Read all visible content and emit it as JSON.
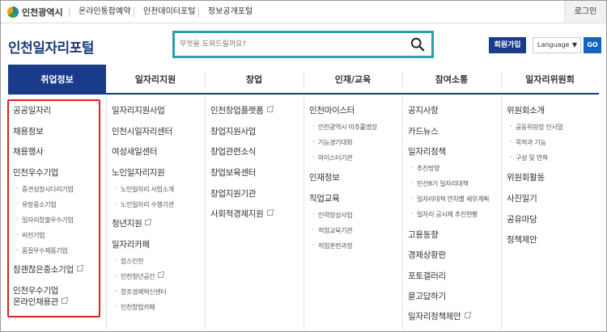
{
  "topbar": {
    "logo": "인천광역시",
    "links": [
      "온라인통합예약",
      "인천데이터포털",
      "정보공개포털"
    ],
    "login": "로그인"
  },
  "header": {
    "brand": "인천일자리포털",
    "search_placeholder": "무엇을 도와드릴까요?",
    "join": "회원가입",
    "language": "Language",
    "go": "GO"
  },
  "nav": [
    "취업정보",
    "일자리지원",
    "창업",
    "인재/교육",
    "참여소통",
    "일자리위원회"
  ],
  "menu": {
    "c1": [
      "공공일자리",
      "채용정보",
      "채용행사",
      "인천우수기업",
      "중견성장사다리기업",
      "유망중소기업",
      "일자리창출우수기업",
      "비전기업",
      "품질우수제품기업",
      "참괜찮은중소기업",
      "인천우수기업",
      "온라인채용관"
    ],
    "c2": [
      "일자리지원사업",
      "인천시일자리센터",
      "여성새일센터",
      "노인일자리지원",
      "노인일자리 사업소개",
      "노인일자리 수행기관",
      "청년지원",
      "일자리카페",
      "잡스인천",
      "인천청년공간",
      "창조경제혁신센터",
      "인천창업카페"
    ],
    "c3": [
      "인천창업플랫폼",
      "창업지원사업",
      "창업관련소식",
      "창업보육센터",
      "창업지원기관",
      "사회적경제지원"
    ],
    "c4": [
      "인천마이스터",
      "인천광역시 미추홀명장",
      "기능경기대회",
      "마이스터기관",
      "인재정보",
      "직업교육",
      "인력양성사업",
      "직업교육기관",
      "직업훈련과정"
    ],
    "c5": [
      "공지사항",
      "카드뉴스",
      "일자리정책",
      "추진방향",
      "민선8기 일자리대책",
      "일자리대책 연차별 세부계획",
      "일자리 공시제 추진현황",
      "고용동향",
      "경제상황판",
      "포토갤러리",
      "묻고답하기",
      "일자리정책제안"
    ],
    "c6": [
      "위원회소개",
      "공동위원장 인사말",
      "목적과 기능",
      "구성 및 연혁",
      "위원회활동",
      "사진일기",
      "공유마당",
      "정책제안"
    ]
  },
  "colors": {
    "navy": "#1a3a8a",
    "teal": "#2aa0a8",
    "red": "#e02020",
    "go": "#1565c0"
  }
}
